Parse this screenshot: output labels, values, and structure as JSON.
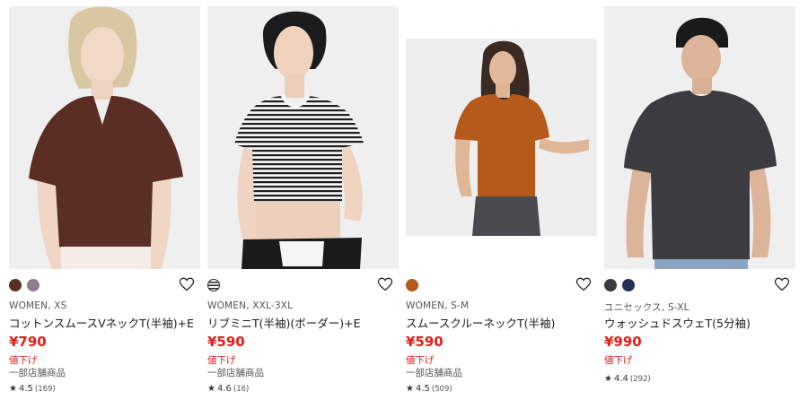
{
  "products": [
    {
      "colors": [
        "#5a2e25",
        "#8e7d8f"
      ],
      "meta": "WOMEN, XS",
      "name": "コットンスムースVネックT(半袖)+E",
      "price": "¥790",
      "sale": "値下げ",
      "stock": "一部店舗商品",
      "rating": "4.5",
      "reviews": "(169)"
    },
    {
      "colors": [
        "stripe"
      ],
      "meta": "WOMEN, XXL-3XL",
      "name": "リブミニT(半袖)(ボーダー)+E",
      "price": "¥590",
      "sale": "値下げ",
      "stock": "一部店舗商品",
      "rating": "4.6",
      "reviews": "(16)"
    },
    {
      "colors": [
        "#b55a1a"
      ],
      "meta": "WOMEN, S-M",
      "name": "スムースクルーネックT(半袖)",
      "price": "¥590",
      "sale": "値下げ",
      "stock": "一部店舗商品",
      "rating": "4.5",
      "reviews": "(509)"
    },
    {
      "colors": [
        "#3c3c40",
        "#23305a"
      ],
      "meta": "ユニセックス, S-XL",
      "name": "ウォッシュドスウェT(5分袖)",
      "price": "¥990",
      "sale": "値下げ",
      "stock": "",
      "rating": "4.4",
      "reviews": "(292)"
    }
  ],
  "icons": {
    "favorite": "heart-outline-icon",
    "rating": "star-icon"
  },
  "accent": "#e0201a"
}
